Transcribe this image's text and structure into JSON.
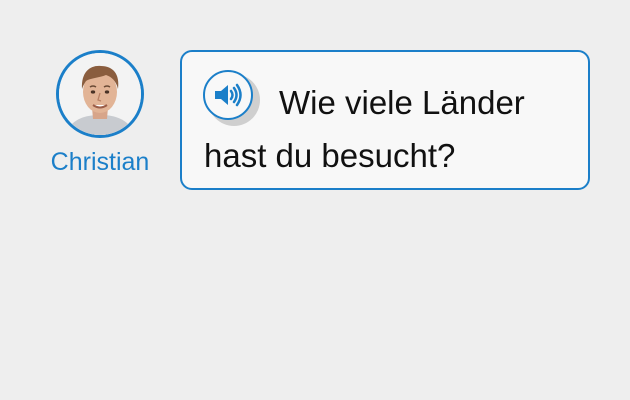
{
  "speaker": {
    "name": "Christian",
    "avatar_icon": "person-photo"
  },
  "message": {
    "text": "Wie viele Länder hast du besucht?",
    "audio_icon": "speaker-volume-icon"
  },
  "colors": {
    "accent": "#1b7fc9",
    "background": "#eeeeee",
    "bubble": "#f8f8f8",
    "text": "#111111"
  }
}
